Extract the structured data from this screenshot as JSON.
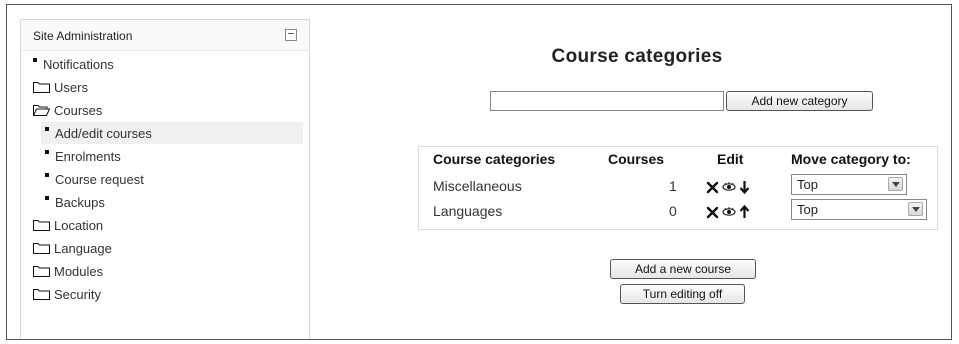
{
  "sidebar": {
    "title": "Site Administration",
    "collapse_symbol": "−",
    "items": [
      {
        "label": "Notifications",
        "icon": "bullet-icon"
      },
      {
        "label": "Users",
        "icon": "folder-icon"
      },
      {
        "label": "Courses",
        "icon": "folder-open-icon"
      },
      {
        "label": "Add/edit courses",
        "icon": "bullet-icon",
        "selected": true
      },
      {
        "label": "Enrolments",
        "icon": "bullet-icon"
      },
      {
        "label": "Course request",
        "icon": "bullet-icon"
      },
      {
        "label": "Backups",
        "icon": "bullet-icon"
      },
      {
        "label": "Location",
        "icon": "folder-icon"
      },
      {
        "label": "Language",
        "icon": "folder-icon"
      },
      {
        "label": "Modules",
        "icon": "folder-icon"
      },
      {
        "label": "Security",
        "icon": "folder-icon"
      }
    ]
  },
  "main": {
    "title": "Course categories",
    "new_category": {
      "input_value": "",
      "button_label": "Add new category"
    },
    "table": {
      "headers": [
        "Course categories",
        "Courses",
        "Edit",
        "Move category to:"
      ],
      "rows": [
        {
          "name": "Miscellaneous",
          "courses": "1",
          "move_arrow": "down-arrow-icon",
          "move_to": "Top"
        },
        {
          "name": "Languages",
          "courses": "0",
          "move_arrow": "up-arrow-icon",
          "move_to": "Top"
        }
      ]
    },
    "buttons": {
      "add_course": "Add a new course",
      "editing": "Turn editing off"
    }
  }
}
